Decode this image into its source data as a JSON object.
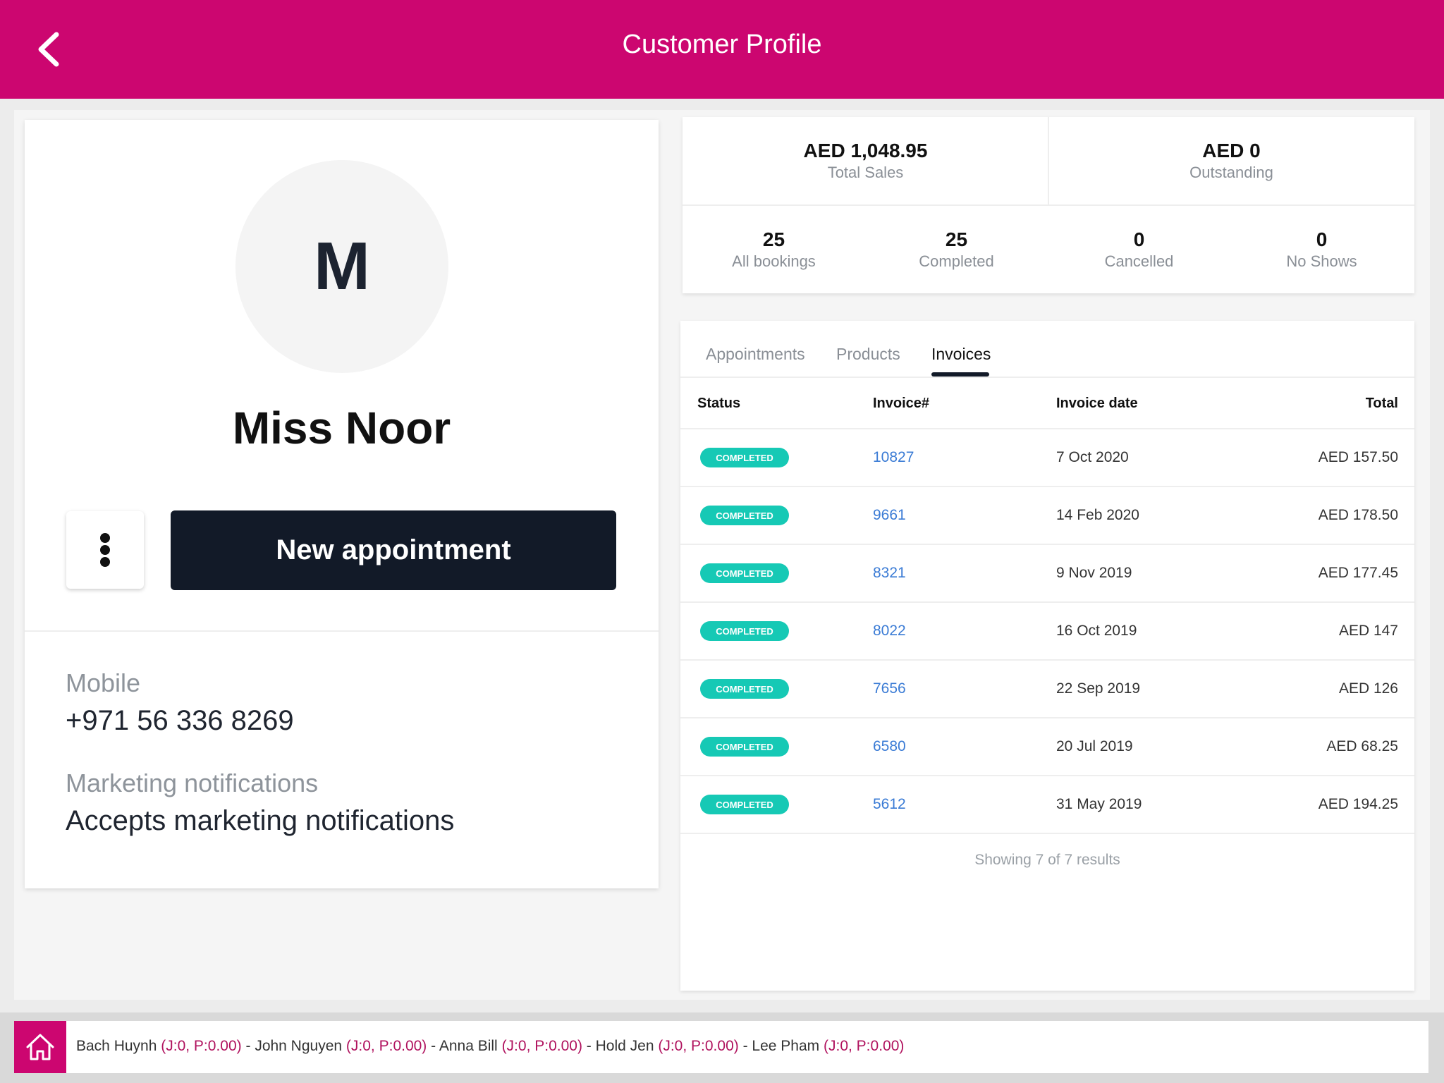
{
  "header": {
    "title": "Customer Profile",
    "accent_color": "#cc0670",
    "back_icon": "chevron-left-icon"
  },
  "profile": {
    "avatar_initial": "M",
    "name": "Miss Noor",
    "more_icon": "more-vertical-icon",
    "new_appointment_label": "New appointment",
    "mobile_label": "Mobile",
    "mobile_value": "+971 56 336 8269",
    "marketing_label": "Marketing notifications",
    "marketing_value": "Accepts marketing notifications"
  },
  "stats": {
    "total_sales": {
      "value": "AED 1,048.95",
      "label": "Total Sales"
    },
    "outstanding": {
      "value": "AED 0",
      "label": "Outstanding"
    },
    "all_bookings": {
      "value": "25",
      "label": "All bookings"
    },
    "completed": {
      "value": "25",
      "label": "Completed"
    },
    "cancelled": {
      "value": "0",
      "label": "Cancelled"
    },
    "no_shows": {
      "value": "0",
      "label": "No Shows"
    }
  },
  "tabs": [
    {
      "label": "Appointments",
      "active": false
    },
    {
      "label": "Products",
      "active": false
    },
    {
      "label": "Invoices",
      "active": true
    }
  ],
  "invoices": {
    "columns": [
      "Status",
      "Invoice#",
      "Invoice date",
      "Total"
    ],
    "badge_color": "#16c9b5",
    "rows": [
      {
        "status": "COMPLETED",
        "invoice": "10827",
        "date": "7 Oct 2020",
        "total": "AED 157.50"
      },
      {
        "status": "COMPLETED",
        "invoice": "9661",
        "date": "14 Feb 2020",
        "total": "AED 178.50"
      },
      {
        "status": "COMPLETED",
        "invoice": "8321",
        "date": "9 Nov 2019",
        "total": "AED 177.45"
      },
      {
        "status": "COMPLETED",
        "invoice": "8022",
        "date": "16 Oct 2019",
        "total": "AED 147"
      },
      {
        "status": "COMPLETED",
        "invoice": "7656",
        "date": "22 Sep 2019",
        "total": "AED 126"
      },
      {
        "status": "COMPLETED",
        "invoice": "6580",
        "date": "20 Jul 2019",
        "total": "AED 68.25"
      },
      {
        "status": "COMPLETED",
        "invoice": "5612",
        "date": "31 May 2019",
        "total": "AED 194.25"
      }
    ],
    "footer": "Showing 7 of 7 results"
  },
  "bottom_bar": {
    "home_icon": "home-icon",
    "staff": [
      {
        "name": "Bach Huynh",
        "stats": "(J:0, P:0.00)"
      },
      {
        "name": "John Nguyen",
        "stats": "(J:0, P:0.00)"
      },
      {
        "name": "Anna Bill",
        "stats": "(J:0, P:0.00)"
      },
      {
        "name": "Hold Jen",
        "stats": "(J:0, P:0.00)"
      },
      {
        "name": "Lee Pham",
        "stats": "(J:0, P:0.00)"
      }
    ],
    "separator": " - "
  }
}
